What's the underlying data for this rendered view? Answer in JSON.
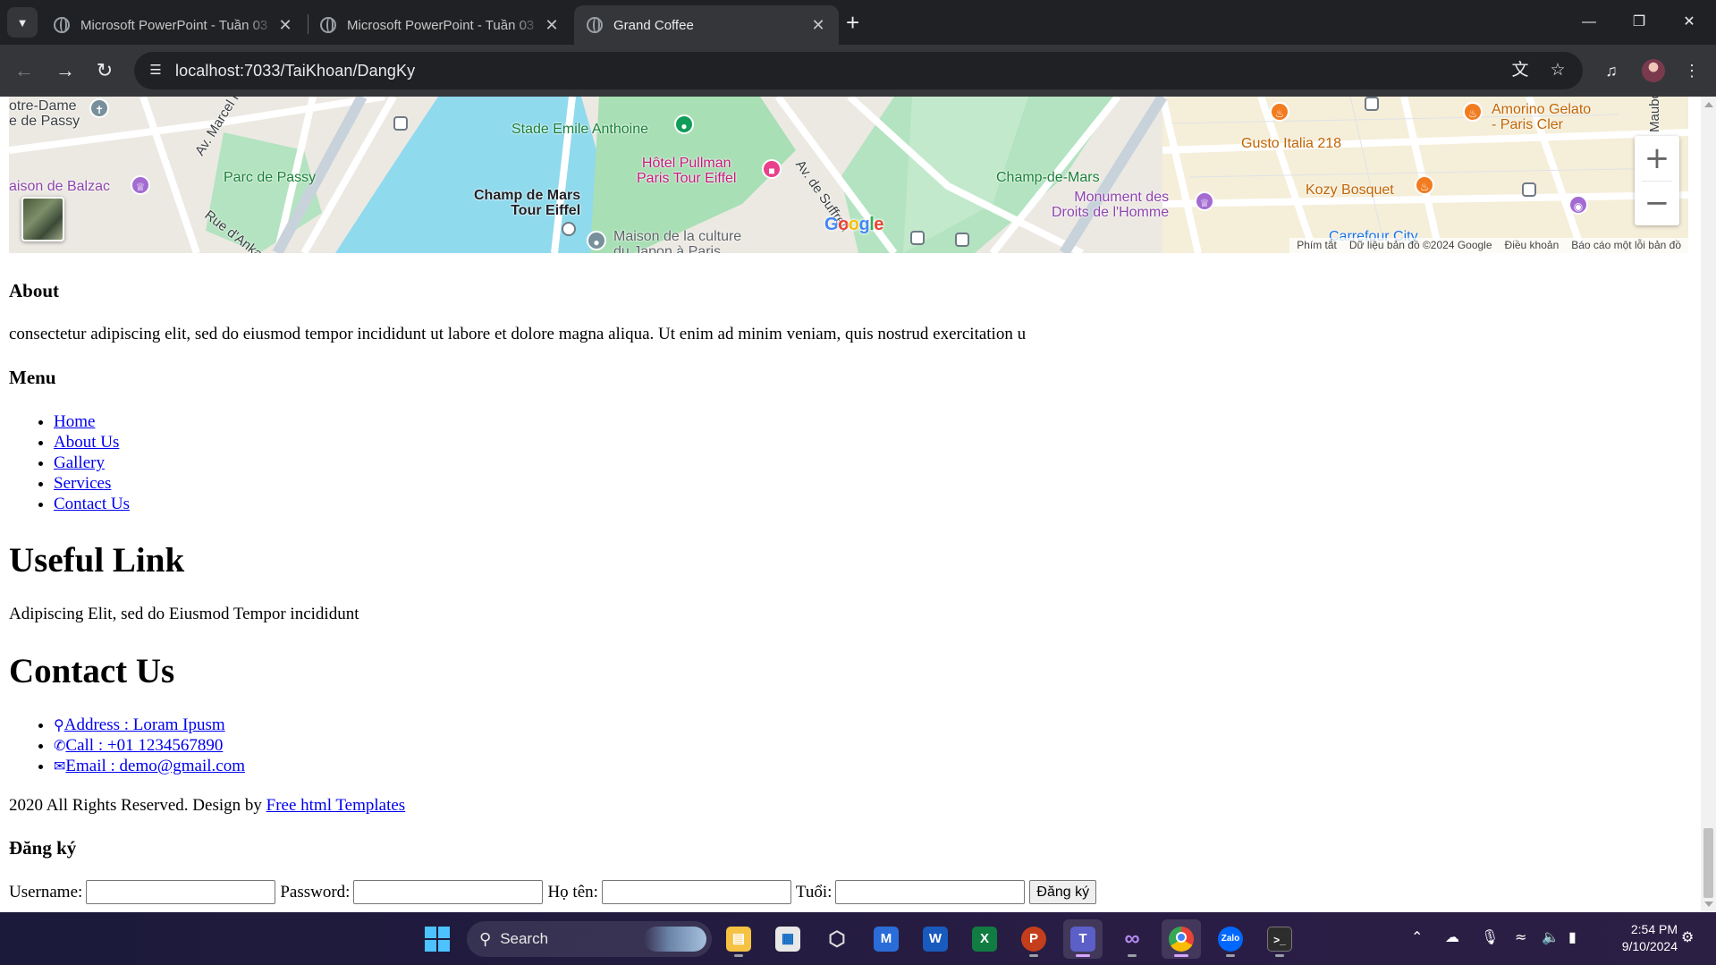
{
  "browser": {
    "tabs": [
      {
        "title": "Microsoft PowerPoint - Tuần 03",
        "active": false
      },
      {
        "title": "Microsoft PowerPoint - Tuần 03",
        "active": false
      },
      {
        "title": "Grand Coffee",
        "active": true
      }
    ],
    "url": "localhost:7033/TaiKhoan/DangKy",
    "icons": {
      "tab_search": "chevron-down-icon",
      "new_tab": "plus-icon",
      "back": "arrow-left-icon",
      "forward": "arrow-right-icon",
      "reload": "reload-icon",
      "site_info": "tune-icon",
      "translate": "translate-icon",
      "bookmark": "star-icon",
      "media": "media-control-icon",
      "menu": "kebab-menu-icon"
    }
  },
  "map": {
    "labels": {
      "notre_dame": "otre-Dame\ne de Passy",
      "maison_balzac": "aison de Balzac",
      "parc_passy": "Parc de Passy",
      "av_marcel_proust": "Av. Marcel Proust",
      "rue_ankara": "Rue d'Anka",
      "stade": "Stade Emile Anthoine",
      "champ_mars_tour": "Champ de Mars\nTour Eiffel",
      "hotel_pullman": "Hôtel Pullman\nParis Tour Eiffel",
      "maison_culture": "Maison de la culture\ndu Japon à Paris",
      "av_suffren": "Av. de Suffren",
      "champ_de_mars": "Champ-de-Mars",
      "monument": "Monument des\nDroits de l'Homme",
      "gusto": "Gusto Italia 218",
      "kozy": "Kozy Bosquet",
      "amorino": "Amorino Gelato\n- Paris Cler",
      "carrefour": "Carrefour City",
      "raubourg": "Maubou"
    },
    "google": "Google",
    "footer": [
      "Phím tắt",
      "Dữ liệu bản đồ ©2024 Google",
      "Điều khoản",
      "Báo cáo một lỗi bản đồ"
    ]
  },
  "about": {
    "heading": "About",
    "text": "consectetur adipiscing elit, sed do eiusmod tempor incididunt ut labore et dolore magna aliqua. Ut enim ad minim veniam, quis nostrud exercitation u"
  },
  "menu": {
    "heading": "Menu",
    "items": [
      "Home",
      "About Us",
      "Gallery",
      "Services",
      "Contact Us"
    ]
  },
  "useful": {
    "heading": "Useful Link",
    "text": "Adipiscing Elit, sed do Eiusmod Tempor incididunt"
  },
  "contact": {
    "heading": "Contact Us",
    "items": [
      {
        "icon": "map-marker-icon",
        "text": "Address : Loram Ipusm"
      },
      {
        "icon": "phone-icon",
        "text": "Call : +01 1234567890"
      },
      {
        "icon": "envelope-icon",
        "text": "Email : demo@gmail.com"
      }
    ]
  },
  "footer": {
    "text": "2020 All Rights Reserved. Design by ",
    "link": "Free html Templates"
  },
  "register": {
    "heading": "Đăng ký",
    "fields": [
      {
        "label": "Username:",
        "value": ""
      },
      {
        "label": "Password:",
        "value": ""
      },
      {
        "label": "Họ tên:",
        "value": ""
      },
      {
        "label": "Tuổi:",
        "value": ""
      }
    ],
    "submit": "Đăng ký"
  },
  "taskbar": {
    "search": "Search",
    "apps": [
      "start-icon",
      "search-icon",
      "file-explorer-icon",
      "microsoft-store-icon",
      "unity-icon",
      "visual-studio-code-icon",
      "word-icon",
      "excel-icon",
      "powerpoint-icon",
      "teams-icon",
      "visual-studio-icon",
      "chrome-icon",
      "zalo-icon",
      "terminal-icon"
    ],
    "time": "2:54 PM",
    "date": "9/10/2024"
  }
}
